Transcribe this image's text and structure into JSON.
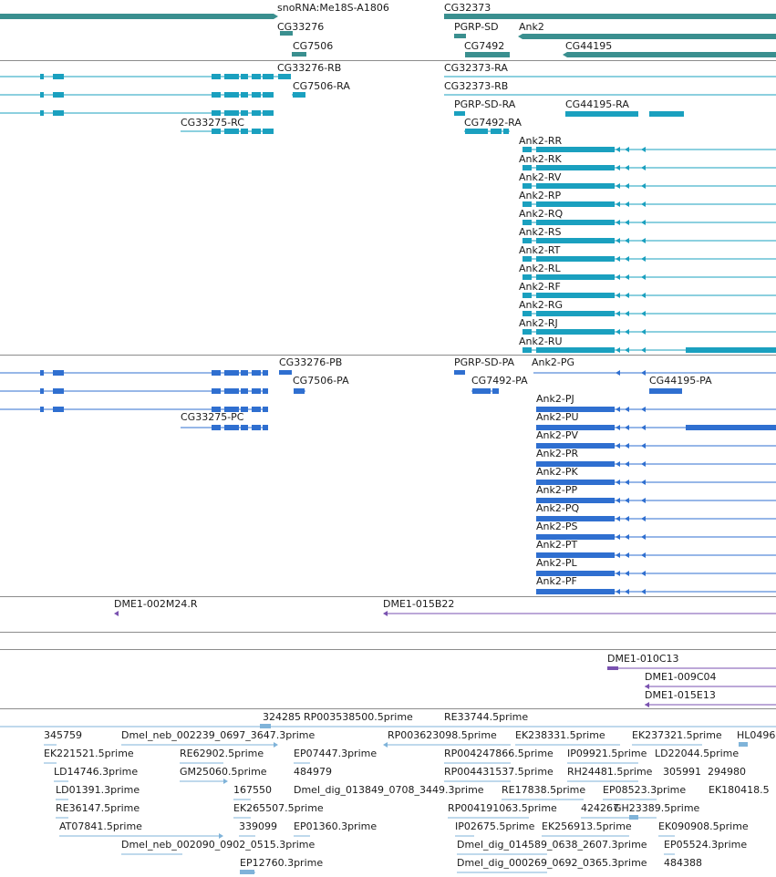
{
  "colors": {
    "gene": "#3a8f8f",
    "mrna": "#1aa0bf",
    "protein": "#2f6fd0",
    "clone": "#7a52b0",
    "est": "#7fb3d9",
    "separator": "#8c8c8c"
  },
  "tracks": {
    "genes": {
      "labels": [
        "snoRNA:Me18S-A1806",
        "CG32373",
        "CG33276",
        "PGRP-SD",
        "Ank2",
        "CG7506",
        "CG7492",
        "CG44195"
      ]
    },
    "transcripts": {
      "labels": [
        "CG33276-RB",
        "CG32373-RA",
        "CG7506-RA",
        "CG32373-RB",
        "PGRP-SD-RA",
        "CG44195-RA",
        "CG33275-RC",
        "CG7492-RA",
        "Ank2-RR",
        "Ank2-RK",
        "Ank2-RV",
        "Ank2-RP",
        "Ank2-RQ",
        "Ank2-RS",
        "Ank2-RT",
        "Ank2-RL",
        "Ank2-RF",
        "Ank2-RG",
        "Ank2-RJ",
        "Ank2-RU"
      ]
    },
    "proteins": {
      "labels": [
        "CG33276-PB",
        "PGRP-SD-PA",
        "Ank2-PG",
        "CG7506-PA",
        "CG7492-PA",
        "CG44195-PA",
        "CG33275-PC",
        "Ank2-PJ",
        "Ank2-PU",
        "Ank2-PV",
        "Ank2-PR",
        "Ank2-PK",
        "Ank2-PP",
        "Ank2-PQ",
        "Ank2-PS",
        "Ank2-PT",
        "Ank2-PL",
        "Ank2-PF"
      ]
    },
    "clones_a": {
      "labels": [
        "DME1-002M24.R",
        "DME1-015B22"
      ]
    },
    "clones_b": {
      "labels": [
        "DME1-010C13",
        "DME1-009C04",
        "DME1-015E13"
      ]
    },
    "ests": {
      "labels": [
        "324285",
        "RP003538500.5prime",
        "RE33744.5prime",
        "345759",
        "Dmel_neb_002239_0697_3647.3prime",
        "RP003623098.5prime",
        "EK238331.5prime",
        "EK237321.5prime",
        "HL0496",
        "EK221521.5prime",
        "RE62902.5prime",
        "EP07447.3prime",
        "RP004247866.5prime",
        "IP09921.5prime",
        "LD22044.5prime",
        "LD14746.3prime",
        "GM25060.5prime",
        "484979",
        "RP004431537.5prime",
        "RH24481.5prime",
        "305991",
        "294980",
        "LD01391.3prime",
        "167550",
        "Dmel_dig_013849_0708_3449.3prime",
        "RE17838.5prime",
        "EP08523.3prime",
        "EK180418.5",
        "RE36147.5prime",
        "EK265507.5prime",
        "RP004191063.5prime",
        "424267",
        "GH23389.5prime",
        "AT07841.5prime",
        "339099",
        "EP01360.3prime",
        "IP02675.5prime",
        "EK256913.5prime",
        "EK090908.5prime",
        "Dmel_neb_002090_0902_0515.3prime",
        "Dmel_dig_014589_0638_2607.3prime",
        "EP05524.3prime",
        "EP12760.3prime",
        "Dmel_dig_000269_0692_0365.3prime",
        "484388"
      ]
    }
  }
}
